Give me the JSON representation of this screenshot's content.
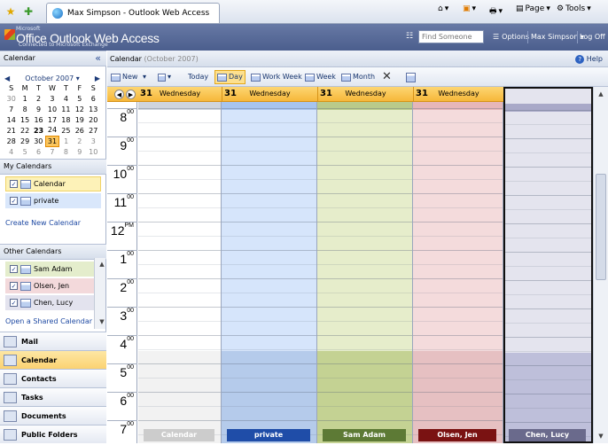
{
  "browser": {
    "tab_title": "Max Simpson - Outlook Web Access",
    "page_label": "Page",
    "tools_label": "Tools"
  },
  "owa": {
    "brand_microsoft": "Microsoft",
    "brand_app": "Office Outlook Web Access",
    "brand_sub": "Connected to Microsoft Exchange",
    "find_placeholder": "Find Someone",
    "options_label": "Options",
    "user_name": "Max Simpson",
    "logoff_label": "Log Off"
  },
  "left": {
    "calendar_header": "Calendar",
    "mini_cal": {
      "month_label": "October 2007",
      "weekdays": [
        "S",
        "M",
        "T",
        "W",
        "T",
        "F",
        "S"
      ],
      "weeks": [
        [
          {
            "d": "30",
            "o": true
          },
          {
            "d": "1"
          },
          {
            "d": "2"
          },
          {
            "d": "3"
          },
          {
            "d": "4"
          },
          {
            "d": "5"
          },
          {
            "d": "6"
          }
        ],
        [
          {
            "d": "7"
          },
          {
            "d": "8"
          },
          {
            "d": "9"
          },
          {
            "d": "10"
          },
          {
            "d": "11"
          },
          {
            "d": "12"
          },
          {
            "d": "13"
          }
        ],
        [
          {
            "d": "14"
          },
          {
            "d": "15"
          },
          {
            "d": "16"
          },
          {
            "d": "17"
          },
          {
            "d": "18"
          },
          {
            "d": "19"
          },
          {
            "d": "20"
          }
        ],
        [
          {
            "d": "21"
          },
          {
            "d": "22"
          },
          {
            "d": "23",
            "b": true
          },
          {
            "d": "24"
          },
          {
            "d": "25"
          },
          {
            "d": "26"
          },
          {
            "d": "27"
          }
        ],
        [
          {
            "d": "28"
          },
          {
            "d": "29"
          },
          {
            "d": "30"
          },
          {
            "d": "31",
            "t": true
          },
          {
            "d": "1",
            "o": true
          },
          {
            "d": "2",
            "o": true
          },
          {
            "d": "3",
            "o": true
          }
        ],
        [
          {
            "d": "4",
            "o": true
          },
          {
            "d": "5",
            "o": true
          },
          {
            "d": "6",
            "o": true
          },
          {
            "d": "7",
            "o": true
          },
          {
            "d": "8",
            "o": true
          },
          {
            "d": "9",
            "o": true
          },
          {
            "d": "10",
            "o": true
          }
        ]
      ]
    },
    "my_calendars_header": "My Calendars",
    "my_calendars": [
      {
        "label": "Calendar",
        "bg": "#fdf2b8"
      },
      {
        "label": "private",
        "bg": "#d9e7fb"
      }
    ],
    "create_new_label": "Create New Calendar",
    "other_calendars_header": "Other Calendars",
    "other_calendars": [
      {
        "label": "Sam Adam",
        "bg": "#e4edcc"
      },
      {
        "label": "Olsen, Jen",
        "bg": "#f3d9db"
      },
      {
        "label": "Chen, Lucy",
        "bg": "#e3e3ee"
      }
    ],
    "open_shared_label": "Open a Shared Calendar ..."
  },
  "nav": [
    {
      "label": "Mail",
      "name": "nav-mail",
      "icon": "mail-icon",
      "selected": false
    },
    {
      "label": "Calendar",
      "name": "nav-calendar",
      "icon": "calendar-icon",
      "selected": true
    },
    {
      "label": "Contacts",
      "name": "nav-contacts",
      "icon": "contacts-icon",
      "selected": false
    },
    {
      "label": "Tasks",
      "name": "nav-tasks",
      "icon": "tasks-icon",
      "selected": false
    },
    {
      "label": "Documents",
      "name": "nav-documents",
      "icon": "documents-icon",
      "selected": false
    },
    {
      "label": "Public Folders",
      "name": "nav-public-folders",
      "icon": "public-folders-icon",
      "selected": false
    }
  ],
  "main": {
    "title": "Calendar",
    "subtitle": "(October 2007)",
    "help_label": "Help",
    "toolbar": {
      "new_label": "New",
      "today_label": "Today",
      "day_label": "Day",
      "work_week_label": "Work Week",
      "week_label": "Week",
      "month_label": "Month"
    },
    "hours": [
      {
        "h": "8",
        "s": "00"
      },
      {
        "h": "9",
        "s": "00"
      },
      {
        "h": "10",
        "s": "00"
      },
      {
        "h": "11",
        "s": "00"
      },
      {
        "h": "12",
        "s": "PM"
      },
      {
        "h": "1",
        "s": "00"
      },
      {
        "h": "2",
        "s": "00"
      },
      {
        "h": "3",
        "s": "00"
      },
      {
        "h": "4",
        "s": "00"
      },
      {
        "h": "5",
        "s": "00"
      },
      {
        "h": "6",
        "s": "00"
      },
      {
        "h": "7",
        "s": "00"
      }
    ],
    "columns": [
      {
        "date": "31",
        "weekday": "Wednesday",
        "label": "Calendar",
        "color": "#ffffff",
        "strip": "#cfd4dc",
        "off": "#f2f2f2",
        "label_bg": "#cccccc"
      },
      {
        "date": "31",
        "weekday": "Wednesday",
        "label": "private",
        "color": "#d6e5fb",
        "strip": "#a7c4ee",
        "off": "#b5cbeb",
        "label_bg": "#1f4da8"
      },
      {
        "date": "31",
        "weekday": "Wednesday",
        "label": "Sam Adam",
        "color": "#e6edcb",
        "strip": "#b9ca8b",
        "off": "#c4d293",
        "label_bg": "#5d7a35"
      },
      {
        "date": "31",
        "weekday": "Wednesday",
        "label": "Olsen, Jen",
        "color": "#f4dbdc",
        "strip": "#e6b6b9",
        "off": "#e6c0c2",
        "label_bg": "#7a1212"
      },
      {
        "date": "31",
        "weekday": "Wednesday",
        "label": "Chen, Lucy",
        "color": "#e4e4ee",
        "strip": "#a9a9c8",
        "off": "#bebfda",
        "label_bg": "#6a6a8c"
      }
    ]
  }
}
